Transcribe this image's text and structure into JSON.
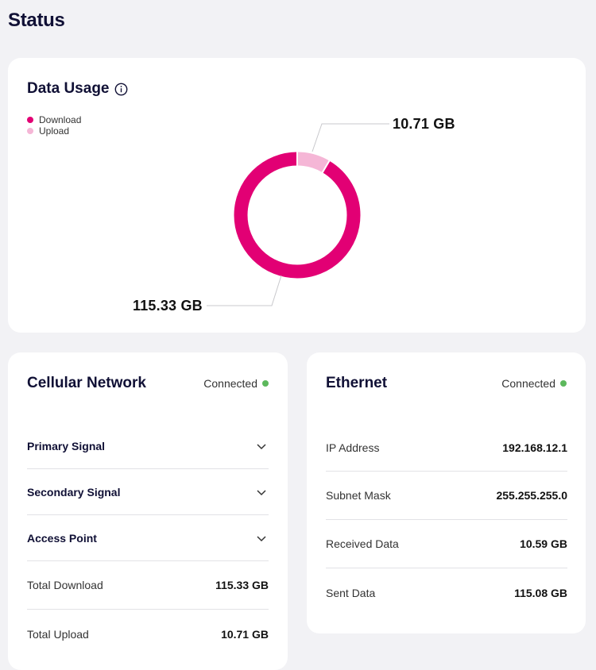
{
  "page": {
    "title": "Status"
  },
  "data_usage": {
    "title": "Data Usage",
    "legend": [
      {
        "label": "Download",
        "color": "#e20074"
      },
      {
        "label": "Upload",
        "color": "#f5b6d6"
      }
    ],
    "download_label": "115.33 GB",
    "upload_label": "10.71 GB",
    "download_gb": 115.33,
    "upload_gb": 10.71
  },
  "cellular": {
    "title": "Cellular Network",
    "status": "Connected",
    "sections": [
      {
        "label": "Primary Signal"
      },
      {
        "label": "Secondary Signal"
      },
      {
        "label": "Access Point"
      }
    ],
    "rows": [
      {
        "label": "Total Download",
        "value": "115.33 GB"
      },
      {
        "label": "Total Upload",
        "value": "10.71 GB"
      }
    ]
  },
  "ethernet": {
    "title": "Ethernet",
    "status": "Connected",
    "rows": [
      {
        "label": "IP Address",
        "value": "192.168.12.1"
      },
      {
        "label": "Subnet Mask",
        "value": "255.255.255.0"
      },
      {
        "label": "Received Data",
        "value": "10.59 GB"
      },
      {
        "label": "Sent Data",
        "value": "115.08 GB"
      }
    ]
  },
  "colors": {
    "accent": "#e20074",
    "accent_light": "#f5b6d6",
    "connected": "#5cb85c"
  },
  "icons": {
    "info": "info-icon",
    "chevron": "chevron-down-icon",
    "status": "status-dot-icon"
  }
}
